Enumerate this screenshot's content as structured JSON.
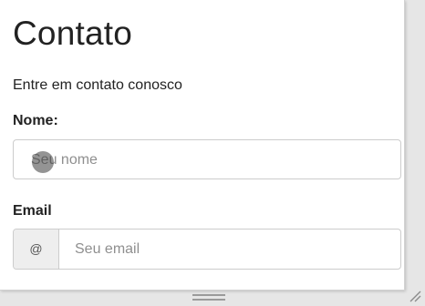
{
  "page": {
    "title": "Contato",
    "subtitle": "Entre em contato conosco"
  },
  "form": {
    "name_label": "Nome:",
    "name_placeholder": "Seu nome",
    "email_label": "Email",
    "email_addon": "@",
    "email_placeholder": "Seu email"
  },
  "icons": {
    "touch_cursor": "touch-cursor-icon",
    "drag_handle": "drag-handle-icon",
    "resize_corner": "resize-corner-icon"
  },
  "colors": {
    "background": "#e6e6e6",
    "card": "#ffffff",
    "border": "#cccccc",
    "addon_bg": "#eeeeee",
    "placeholder": "#8f8f8f"
  }
}
